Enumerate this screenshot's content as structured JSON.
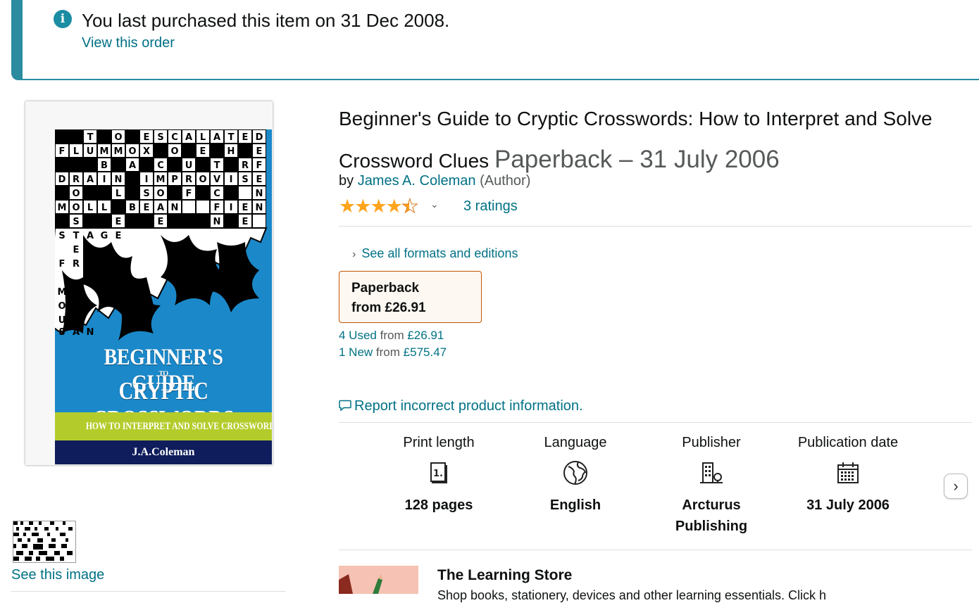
{
  "alert": {
    "message": "You last purchased this item on 31 Dec 2008.",
    "link": "View this order",
    "icon": "info-icon"
  },
  "cover": {
    "title_line1": "BEGINNER'S GUIDE",
    "title_to": "TO",
    "title_line2": "CRYPTIC CROSSWORDS",
    "subtitle": "HOW TO INTERPRET AND SOLVE CROSSWORD CLUES",
    "author": "J.A.Coleman"
  },
  "gallery": {
    "see_image": "See this image"
  },
  "product": {
    "title": "Beginner's Guide to Cryptic Crosswords: How to Interpret and Solve Crossword Clues",
    "format_date": "Paperback – 31 July 2006",
    "by": "by",
    "author": "James A. Coleman",
    "author_role": "(Author)",
    "rating": 4.5,
    "ratings_text": "3 ratings"
  },
  "formats": {
    "see_all": "See all formats and editions",
    "selected_format": "Paperback",
    "selected_price": "from £26.91",
    "offers": [
      {
        "count": "4 Used",
        "from": "from",
        "price": "£26.91"
      },
      {
        "count": "1 New",
        "from": "from",
        "price": "£575.47"
      }
    ]
  },
  "report": "Report incorrect product information.",
  "details": [
    {
      "label": "Print length",
      "value": "128 pages",
      "icon": "book-pages-icon"
    },
    {
      "label": "Language",
      "value": "English",
      "icon": "globe-icon"
    },
    {
      "label": "Publisher",
      "value": "Arcturus Publishing",
      "icon": "building-icon"
    },
    {
      "label": "Publication date",
      "value": "31 July 2006",
      "icon": "calendar-icon"
    }
  ],
  "store": {
    "title": "The Learning Store",
    "subtitle_partial": "Shop books, stationery, devices and other learning essentials. Click h"
  },
  "colors": {
    "link": "#007185",
    "alert_border": "#2b8ca0",
    "star": "#ffa41c",
    "selected_border": "#c45500"
  }
}
